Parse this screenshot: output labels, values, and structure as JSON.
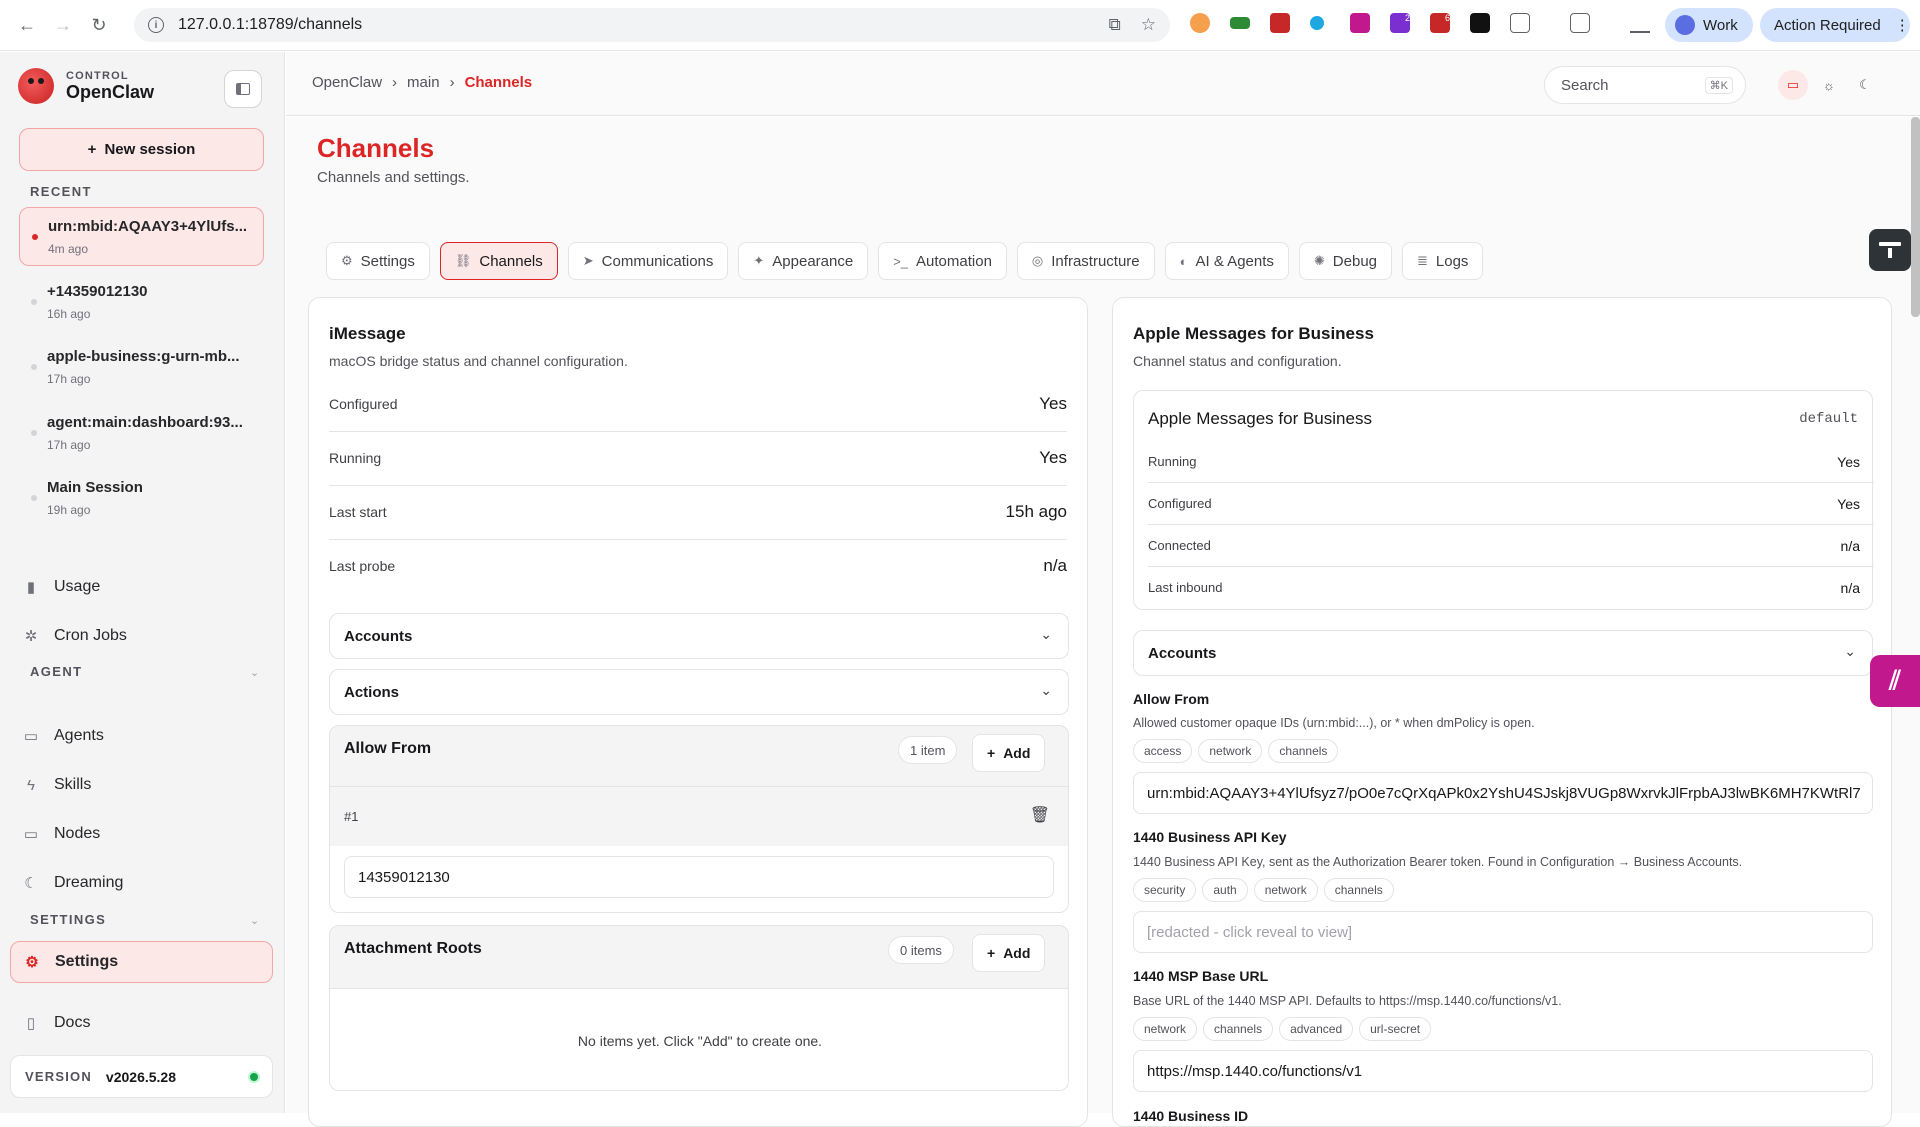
{
  "browser": {
    "url": "127.0.0.1:18789/channels",
    "profile_label": "Work",
    "action_label": "Action Required",
    "ext_badges": [
      "2",
      "6"
    ]
  },
  "sidebar": {
    "brand_small": "CONTROL",
    "brand_name": "OpenClaw",
    "new_session": "New session",
    "recent_label": "RECENT",
    "sessions": [
      {
        "title": "urn:mbid:AQAAY3+4YlUfs...",
        "time": "4m ago"
      },
      {
        "title": "+14359012130",
        "time": "16h ago"
      },
      {
        "title": "apple-business:g-urn-mb...",
        "time": "17h ago"
      },
      {
        "title": "agent:main:dashboard:93...",
        "time": "17h ago"
      },
      {
        "title": "Main Session",
        "time": "19h ago"
      }
    ],
    "usage": "Usage",
    "cron": "Cron Jobs",
    "agent_label": "AGENT",
    "agents": "Agents",
    "skills": "Skills",
    "nodes": "Nodes",
    "dreaming": "Dreaming",
    "settings_label": "SETTINGS",
    "settings": "Settings",
    "docs": "Docs",
    "version_label": "VERSION",
    "version_value": "v2026.5.28"
  },
  "topbar": {
    "crumbs": [
      "OpenClaw",
      "main",
      "Channels"
    ],
    "search_placeholder": "Search",
    "search_kbd": "⌘K"
  },
  "page": {
    "title": "Channels",
    "subtitle": "Channels and settings.",
    "tabs": [
      "Settings",
      "Channels",
      "Communications",
      "Appearance",
      "Automation",
      "Infrastructure",
      "AI & Agents",
      "Debug",
      "Logs"
    ]
  },
  "imessage": {
    "title": "iMessage",
    "subtitle": "macOS bridge status and channel configuration.",
    "rows": [
      {
        "k": "Configured",
        "v": "Yes"
      },
      {
        "k": "Running",
        "v": "Yes"
      },
      {
        "k": "Last start",
        "v": "15h ago"
      },
      {
        "k": "Last probe",
        "v": "n/a"
      }
    ],
    "accounts": "Accounts",
    "actions": "Actions",
    "allow_from": {
      "title": "Allow From",
      "count": "1 item",
      "add": "Add",
      "entry_label": "#1",
      "entry_value": "14359012130"
    },
    "attachment_roots": {
      "title": "Attachment Roots",
      "count": "0 items",
      "add": "Add",
      "empty": "No items yet. Click \"Add\" to create one."
    }
  },
  "amb": {
    "title": "Apple Messages for Business",
    "subtitle": "Channel status and configuration.",
    "inner_title": "Apple Messages for Business",
    "inner_tag": "default",
    "rows": [
      {
        "k": "Running",
        "v": "Yes"
      },
      {
        "k": "Configured",
        "v": "Yes"
      },
      {
        "k": "Connected",
        "v": "n/a"
      },
      {
        "k": "Last inbound",
        "v": "n/a"
      }
    ],
    "accounts": "Accounts",
    "allow_from": {
      "label": "Allow From",
      "help": "Allowed customer opaque IDs (urn:mbid:...), or * when dmPolicy is open.",
      "chips": [
        "access",
        "network",
        "channels"
      ],
      "value": "urn:mbid:AQAAY3+4YlUfsyz7/pO0e7cQrXqAPk0x2YshU4SJskj8VUGp8WxrvkJlFrpbAJ3lwBK6MH7KWtRl7"
    },
    "api_key": {
      "label": "1440 Business API Key",
      "help": "1440 Business API Key, sent as the Authorization Bearer token. Found in Configuration → Business Accounts.",
      "chips": [
        "security",
        "auth",
        "network",
        "channels"
      ],
      "placeholder": "[redacted - click reveal to view]"
    },
    "msp_url": {
      "label": "1440 MSP Base URL",
      "help": "Base URL of the 1440 MSP API. Defaults to https://msp.1440.co/functions/v1.",
      "chips": [
        "network",
        "channels",
        "advanced",
        "url-secret"
      ],
      "value": "https://msp.1440.co/functions/v1"
    },
    "next_label": "1440 Business ID"
  }
}
